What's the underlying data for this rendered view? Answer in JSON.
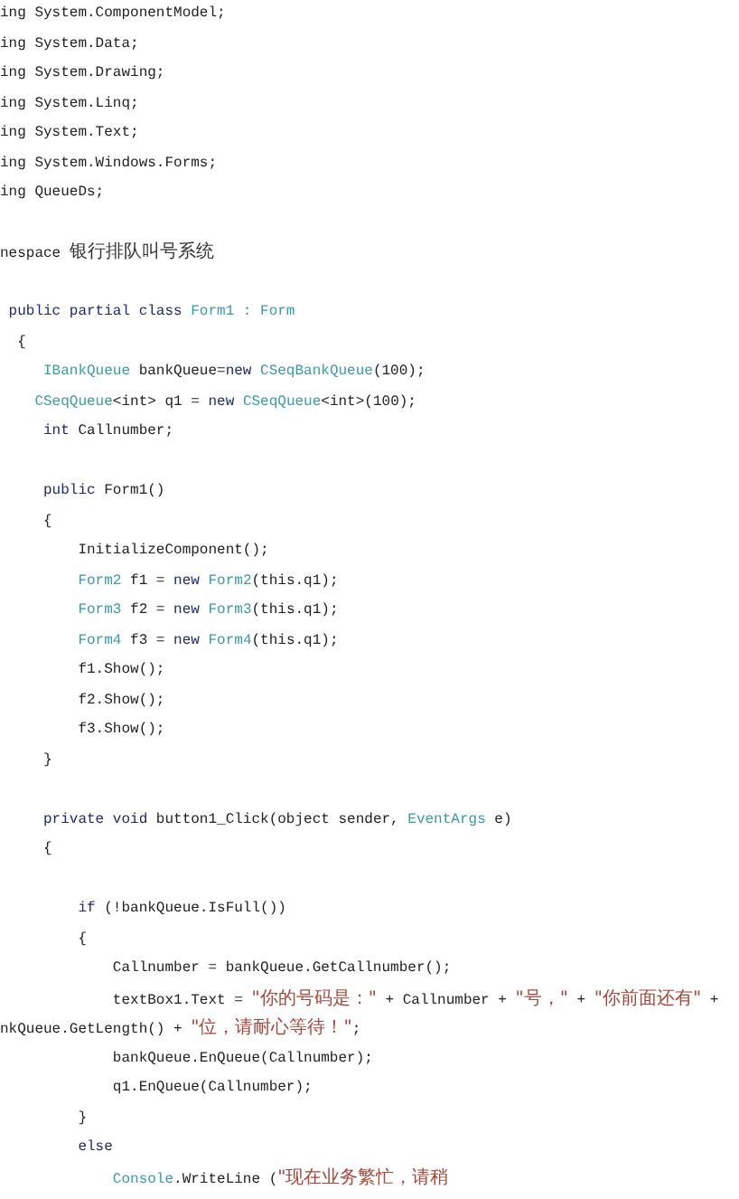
{
  "code_lines": [
    {
      "tokens": [
        {
          "kind": "text",
          "text": "ing System.ComponentModel;"
        }
      ]
    },
    {
      "tokens": [
        {
          "kind": "text",
          "text": "ing System.Data;"
        }
      ]
    },
    {
      "tokens": [
        {
          "kind": "text",
          "text": "ing System.Drawing;"
        }
      ]
    },
    {
      "tokens": [
        {
          "kind": "text",
          "text": "ing System.Linq;"
        }
      ]
    },
    {
      "tokens": [
        {
          "kind": "text",
          "text": "ing System.Text;"
        }
      ]
    },
    {
      "tokens": [
        {
          "kind": "text",
          "text": "ing System.Windows.Forms;"
        }
      ]
    },
    {
      "tokens": [
        {
          "kind": "text",
          "text": "ing QueueDs;"
        }
      ]
    },
    {
      "blank_above": true,
      "tokens": [
        {
          "kind": "text",
          "text": "nespace "
        },
        {
          "kind": "cjk",
          "text": "银行排队叫号系统"
        }
      ]
    },
    {
      "blank_above": true,
      "tokens": [
        {
          "kind": "keyword",
          "text": " public partial class "
        },
        {
          "kind": "type",
          "text": "Form1 : Form"
        }
      ]
    },
    {
      "tokens": [
        {
          "kind": "text",
          "text": "  {"
        }
      ]
    },
    {
      "tokens": [
        {
          "kind": "type",
          "text": "     IBankQueue"
        },
        {
          "kind": "text",
          "text": " bankQueue="
        },
        {
          "kind": "keyword",
          "text": "new "
        },
        {
          "kind": "type",
          "text": "CSeqBankQueue"
        },
        {
          "kind": "text",
          "text": "(100);"
        }
      ]
    },
    {
      "tokens": [
        {
          "kind": "type",
          "text": "    CSeqQueue"
        },
        {
          "kind": "text",
          "text": "<int> q1 = "
        },
        {
          "kind": "keyword",
          "text": "new "
        },
        {
          "kind": "type",
          "text": "CSeqQueue"
        },
        {
          "kind": "text",
          "text": "<int>(100);"
        }
      ]
    },
    {
      "tokens": [
        {
          "kind": "keyword",
          "text": "     int "
        },
        {
          "kind": "text",
          "text": "Callnumber;"
        }
      ]
    },
    {
      "blank_above": true,
      "tokens": [
        {
          "kind": "keyword",
          "text": "     public "
        },
        {
          "kind": "text",
          "text": "Form1()"
        }
      ]
    },
    {
      "tokens": [
        {
          "kind": "text",
          "text": "     {"
        }
      ]
    },
    {
      "tokens": [
        {
          "kind": "text",
          "text": "         InitializeComponent();"
        }
      ]
    },
    {
      "tokens": [
        {
          "kind": "type",
          "text": "         Form2"
        },
        {
          "kind": "text",
          "text": " f1 = "
        },
        {
          "kind": "keyword",
          "text": "new "
        },
        {
          "kind": "type",
          "text": "Form2"
        },
        {
          "kind": "text",
          "text": "(this.q1);"
        }
      ]
    },
    {
      "tokens": [
        {
          "kind": "type",
          "text": "         Form3"
        },
        {
          "kind": "text",
          "text": " f2 = "
        },
        {
          "kind": "keyword",
          "text": "new "
        },
        {
          "kind": "type",
          "text": "Form3"
        },
        {
          "kind": "text",
          "text": "(this.q1);"
        }
      ]
    },
    {
      "tokens": [
        {
          "kind": "type",
          "text": "         Form4"
        },
        {
          "kind": "text",
          "text": " f3 = "
        },
        {
          "kind": "keyword",
          "text": "new "
        },
        {
          "kind": "type",
          "text": "Form4"
        },
        {
          "kind": "text",
          "text": "(this.q1);"
        }
      ]
    },
    {
      "tokens": [
        {
          "kind": "text",
          "text": "         f1.Show();"
        }
      ]
    },
    {
      "tokens": [
        {
          "kind": "text",
          "text": "         f2.Show();"
        }
      ]
    },
    {
      "tokens": [
        {
          "kind": "text",
          "text": "         f3.Show();"
        }
      ]
    },
    {
      "tokens": [
        {
          "kind": "text",
          "text": "     }"
        }
      ]
    },
    {
      "blank_above": true,
      "tokens": [
        {
          "kind": "keyword",
          "text": "     private void "
        },
        {
          "kind": "text",
          "text": "button1_Click(object sender, "
        },
        {
          "kind": "type",
          "text": "EventArgs"
        },
        {
          "kind": "text",
          "text": " e)"
        }
      ]
    },
    {
      "tokens": [
        {
          "kind": "text",
          "text": "     {"
        }
      ]
    },
    {
      "blank_above": true,
      "tokens": [
        {
          "kind": "keyword",
          "text": "         if "
        },
        {
          "kind": "text",
          "text": "(!bankQueue.IsFull())"
        }
      ]
    },
    {
      "tokens": [
        {
          "kind": "text",
          "text": "         {"
        }
      ]
    },
    {
      "tokens": [
        {
          "kind": "text",
          "text": "             Callnumber = bankQueue.GetCallnumber();"
        }
      ]
    },
    {
      "tokens": [
        {
          "kind": "text",
          "text": "             textBox1.Text = "
        },
        {
          "kind": "string",
          "text": "\"你的号码是：\""
        },
        {
          "kind": "text",
          "text": " + Callnumber + "
        },
        {
          "kind": "string",
          "text": "\"号，\""
        },
        {
          "kind": "text",
          "text": " + "
        },
        {
          "kind": "string",
          "text": "\"你前面还有\""
        },
        {
          "kind": "text",
          "text": " +"
        }
      ]
    },
    {
      "tokens": [
        {
          "kind": "text",
          "text": "nkQueue.GetLength() + "
        },
        {
          "kind": "string",
          "text": "\"位，请耐心等待！\""
        },
        {
          "kind": "text",
          "text": ";"
        }
      ]
    },
    {
      "tokens": [
        {
          "kind": "text",
          "text": "             bankQueue.EnQueue(Callnumber);"
        }
      ]
    },
    {
      "tokens": [
        {
          "kind": "text",
          "text": "             q1.EnQueue(Callnumber);"
        }
      ]
    },
    {
      "tokens": [
        {
          "kind": "text",
          "text": "         }"
        }
      ]
    },
    {
      "tokens": [
        {
          "kind": "keyword",
          "text": "         else"
        }
      ]
    },
    {
      "tokens": [
        {
          "kind": "type",
          "text": "             Console"
        },
        {
          "kind": "text",
          "text": ".WriteLine ("
        },
        {
          "kind": "string",
          "text": "\"现在业务繁忙，请稍"
        }
      ]
    }
  ]
}
